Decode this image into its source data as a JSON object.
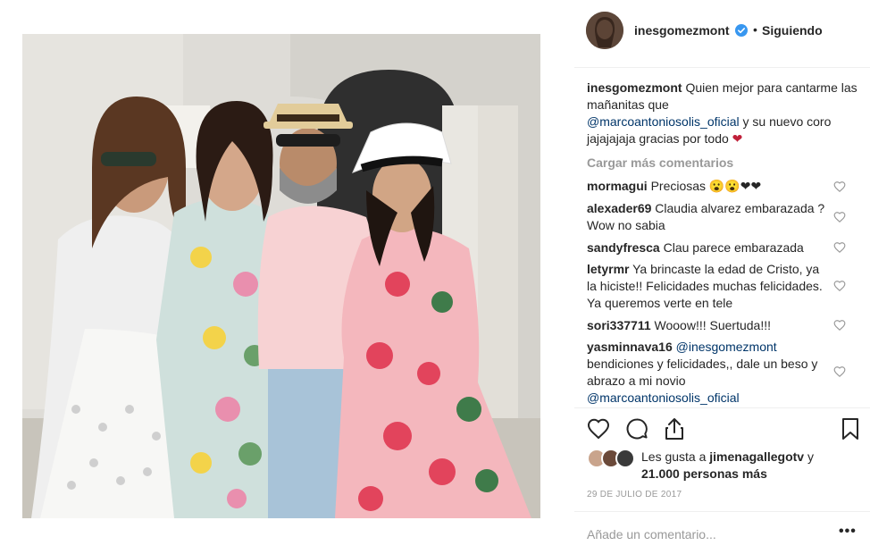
{
  "post": {
    "username": "inesgomezmont",
    "follow_status": "Siguiendo",
    "separator": "•",
    "caption": {
      "username": "inesgomezmont",
      "text_1": "Quien mejor para cantarme las mañanitas que",
      "mention": "@marcoantoniosolis_oficial",
      "text_2": "y su nuevo coro jajajajaja gracias por todo",
      "emoji": "❤"
    },
    "load_more": "Cargar más comentarios",
    "comments": [
      {
        "user": "mormagui",
        "text": "Preciosas 😮😮❤❤"
      },
      {
        "user": "alexader69",
        "text": "Claudia alvarez embarazada ? Wow no sabia"
      },
      {
        "user": "sandyfresca",
        "text": "Clau parece embarazada"
      },
      {
        "user": "letyrmr",
        "text": "Ya brincaste la edad de Cristo, ya la hiciste!! Felicidades muchas felicidades. Ya queremos verte en tele"
      },
      {
        "user": "sori337711",
        "text": "Wooow!!! Suertuda!!!"
      },
      {
        "user": "yasminnava16",
        "mention": "@inesgomezmont",
        "text": "bendiciones y felicidades,, dale un beso y abrazo a mi novio",
        "mention_2": "@marcoantoniosolis_oficial"
      }
    ],
    "likes": {
      "prefix": "Les gusta a",
      "user": "jimenagallegotv",
      "connector": "y",
      "count_text": "21.000 personas más"
    },
    "date": "29 DE JULIO DE 2017",
    "add_comment_placeholder": "Añade un comentario...",
    "more_label": "•••"
  },
  "colors": {
    "verified": "#3897f0",
    "mention": "#003569",
    "muted": "#999999",
    "text": "#262626"
  },
  "icons": {
    "like": "heart-icon",
    "comment": "comment-icon",
    "share": "share-icon",
    "save": "bookmark-icon"
  }
}
